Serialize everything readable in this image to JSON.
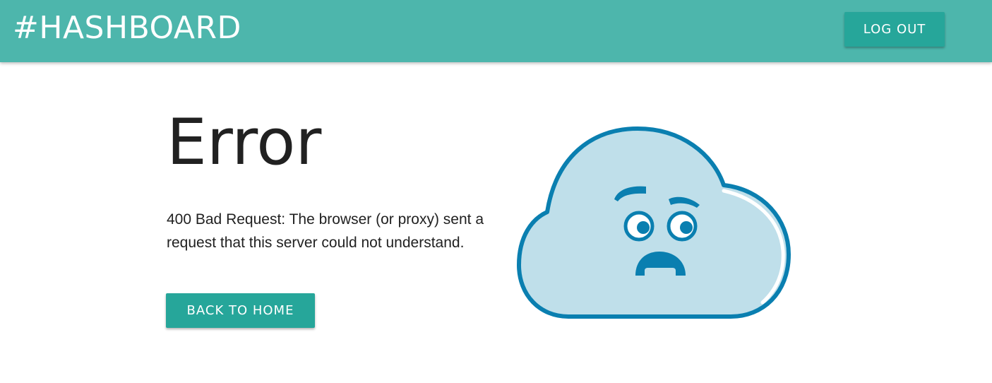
{
  "navbar": {
    "brand": "#HASHBOARD",
    "logout_label": "LOG OUT",
    "background_color": "#4db6ac",
    "button_color": "#26a69a"
  },
  "main": {
    "title": "Error",
    "message": "400 Bad Request: The browser (or proxy) sent a request that this server could not understand.",
    "back_button_label": "BACK TO HOME"
  },
  "illustration": {
    "icon": "sad-cloud-icon",
    "fill_color": "#bfdfea",
    "stroke_color": "#0a7fb0"
  }
}
